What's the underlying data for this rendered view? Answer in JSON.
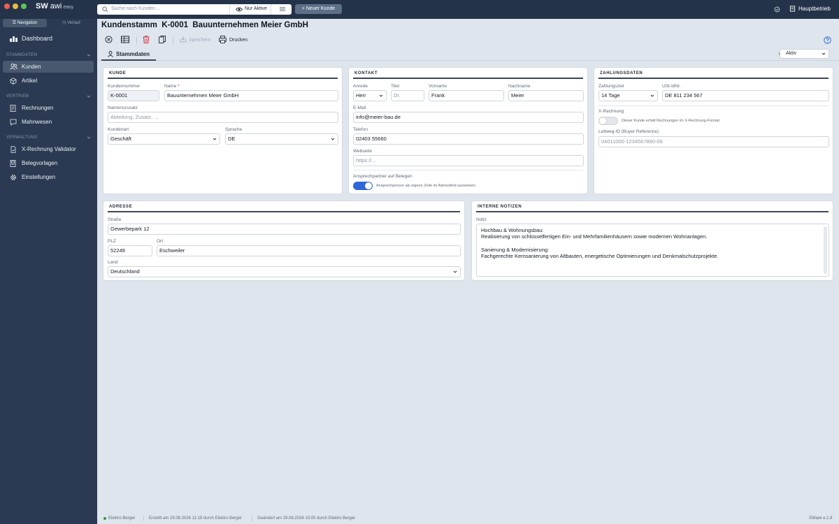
{
  "app": {
    "brand_sw": "SW",
    "brand_awi": "awi",
    "brand_edition": "easy"
  },
  "topbar": {
    "search_placeholder": "Suche nach Kunden ...",
    "filter_label": "Nur Aktive",
    "new_button": "+ Neuer Kunde",
    "company": "Hauptbetrieb"
  },
  "sidebar": {
    "seg_navigation": "Navigation",
    "seg_history": "Verlauf",
    "dashboard": "Dashboard",
    "sections": [
      {
        "title": "STAMMDATEN"
      },
      {
        "title": "VERTRIEB"
      },
      {
        "title": "VERWALTUNG"
      }
    ],
    "items": {
      "kunden": "Kunden",
      "artikel": "Artikel",
      "rechnungen": "Rechnungen",
      "mahnwesen": "Mahnwesen",
      "validator": "X-Rechnung Validator",
      "belegvorlagen": "Belegvorlagen",
      "einstellungen": "Einstellungen"
    }
  },
  "header": {
    "title": "Kundenstamm",
    "number": "K-0001",
    "name": "Bauunternehmen Meier GmbH"
  },
  "toolbar": {
    "save_label": "Speichern",
    "print_label": "Drucken"
  },
  "tabs": {
    "stammdaten": "Stammdaten"
  },
  "status": {
    "value": "Aktiv"
  },
  "kunde": {
    "title": "KUNDE",
    "kundennummer_label": "Kundennummer",
    "kundennummer": "K-0001",
    "name_label": "Name",
    "name_required": "*",
    "name": "Bauunternehmen Meier GmbH",
    "zusatz_label": "Namenszusatz",
    "zusatz_placeholder": "Abteilung, Zusatz, ...",
    "kundenart_label": "Kundenart",
    "kundenart": "Geschäft",
    "sprache_label": "Sprache",
    "sprache": "DE"
  },
  "kontakt": {
    "title": "KONTAKT",
    "anrede_label": "Anrede",
    "anrede": "Herr",
    "titel_label": "Titel",
    "titel_placeholder": "Dr.",
    "vorname_label": "Vorname",
    "vorname": "Frank",
    "nachname_label": "Nachname",
    "nachname": "Meier",
    "email_label": "E-Mail",
    "email": "info@meier-bau.de",
    "telefon_label": "Telefon",
    "telefon": "02403 55660",
    "webseite_label": "Webseite",
    "webseite_placeholder": "https://...",
    "ansprech_label": "Ansprechpartner auf Belegen",
    "ansprech_note": "Ansprechperson als eigene Zeile im Adressfeld ausweisen",
    "ansprech_on": true
  },
  "zahlung": {
    "title": "ZAHLUNGSDATEN",
    "ziel_label": "Zahlungsziel",
    "ziel": "14 Tage",
    "ust_label": "USt-IdNr.",
    "ust": "DE 811 234 567",
    "xr_label": "X-Rechnung",
    "xr_note": "Dieser Kunde erhält Rechnungen im X-Rechnung-Format",
    "xr_on": false,
    "leitweg_label": "Leitweg-ID (Buyer Reference)",
    "leitweg_placeholder": "04011000-1234567890-06"
  },
  "adresse": {
    "title": "ADRESSE",
    "strasse_label": "Straße",
    "strasse": "Gewerbepark 12",
    "plz_label": "PLZ",
    "plz": "52249",
    "ort_label": "Ort",
    "ort": "Eschweiler",
    "land_label": "Land",
    "land": "Deutschland"
  },
  "notizen": {
    "title": "INTERNE NOTIZEN",
    "notiz_label": "Notiz",
    "notiz": "Hochbau & Wohnungsbau:\nRealisierung von schlüsselfertigen Ein- und Mehrfamilienhäusern sowie modernen Wohnanlagen.\n\nSanierung & Modernisierung:\nFachgerechte Kernsanierung von Altbauten, energetische Optimierungen und Denkmalschutzprojekte."
  },
  "footer": {
    "user": "Elektro Berger",
    "created": "Erstellt am 29.08.2026 11:18 durch Elektro Berger",
    "changed": "Geändert am 29.08.2026 15:00 durch Elektro Berger",
    "version": "SWawi e.1.8"
  },
  "colors": {
    "accent": "#2f67d6",
    "sidebar": "#2b3a52",
    "topbar": "#243349",
    "status_ok": "#2f9b43",
    "delete": "#d0323a"
  }
}
